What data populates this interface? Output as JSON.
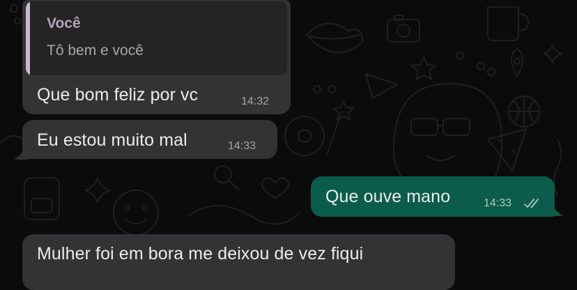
{
  "chat": {
    "messages": [
      {
        "direction": "incoming",
        "quoted": {
          "author": "Você",
          "text": "Tô bem e você"
        },
        "text": "Que bom feliz por vc",
        "time": "14:32"
      },
      {
        "direction": "incoming",
        "text": "Eu estou muito mal",
        "time": "14:33"
      },
      {
        "direction": "outgoing",
        "text": "Que ouve mano",
        "time": "14:33",
        "status": "read-double-check-icon"
      },
      {
        "direction": "incoming",
        "text": "Mulher foi em bora me deixou de vez fiqui"
      }
    ]
  },
  "colors": {
    "background": "#0b0b0c",
    "incoming_bubble": "#333335",
    "outgoing_bubble": "#0b5c4a",
    "quote_accent": "#c7b9d1"
  }
}
